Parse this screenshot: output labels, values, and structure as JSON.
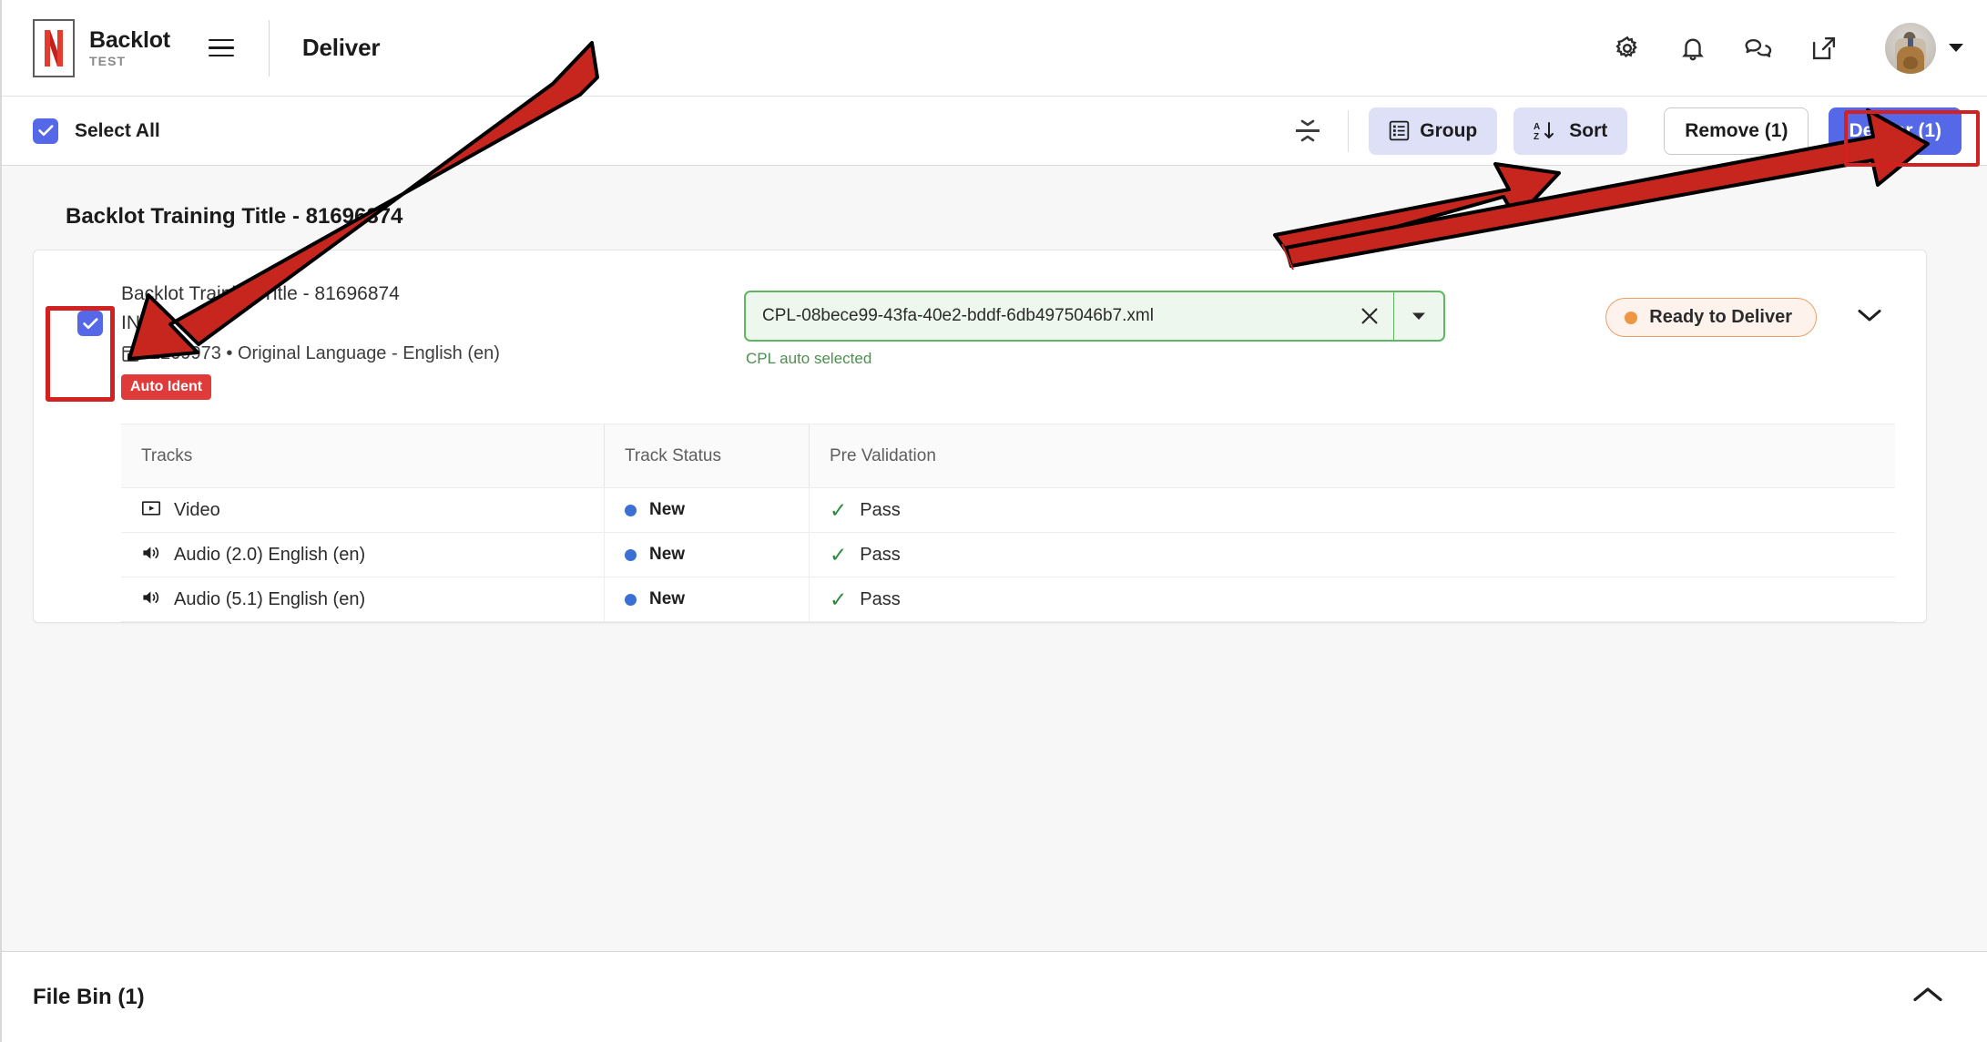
{
  "header": {
    "brand_name": "Backlot",
    "brand_sub": "TEST",
    "page_title": "Deliver",
    "logo_icon": "netflix-n-logo",
    "menu_icon": "hamburger-menu-icon",
    "icons": [
      {
        "name": "settings-gear-icon",
        "glyph": "gear"
      },
      {
        "name": "notifications-bell-icon",
        "glyph": "bell"
      },
      {
        "name": "chat-bubbles-icon",
        "glyph": "chat"
      },
      {
        "name": "open-external-icon",
        "glyph": "external-link"
      }
    ],
    "avatar_name": "user-avatar",
    "avatar_caret": "chevron-down-icon"
  },
  "toolbar": {
    "select_all_label": "Select All",
    "select_all_checked": true,
    "collapse_all_icon": "collapse-all-icon",
    "group_label": "Group",
    "group_icon": "list-icon",
    "sort_label": "Sort",
    "sort_icon": "sort-az-icon",
    "remove_label": "Remove (1)",
    "deliver_label": "Deliver (1)",
    "primary_color": "#5468e8",
    "soft_button_color": "#dde0f7"
  },
  "main": {
    "group_title": "Backlot Training Title - 81696874",
    "card": {
      "checkbox_checked": true,
      "title": "Backlot Training Title - 81696874",
      "subtitle": "IN",
      "meta_icon": "package-box-icon",
      "meta": "2209973 • Original Language - English (en)",
      "tag": "Auto Ident",
      "tag_color": "#e03b3b",
      "cpl_value": "CPL-08bece99-43fa-40e2-bddf-6db4975046b7.xml",
      "cpl_clear_icon": "clear-x-icon",
      "cpl_dropdown_icon": "caret-down-icon",
      "cpl_helper": "CPL auto selected",
      "cpl_border_color": "#5fb761",
      "status_label": "Ready to Deliver",
      "status_color": "#ef9644",
      "expand_icon": "chevron-down-icon"
    },
    "table": {
      "columns": [
        "Tracks",
        "Track Status",
        "Pre Validation"
      ],
      "rows": [
        {
          "icon": "video-icon",
          "track": "Video",
          "status": "New",
          "status_color": "#3b6fd4",
          "validation": "Pass",
          "validation_icon": "check-icon"
        },
        {
          "icon": "audio-icon",
          "track": "Audio (2.0) English (en)",
          "status": "New",
          "status_color": "#3b6fd4",
          "validation": "Pass",
          "validation_icon": "check-icon"
        },
        {
          "icon": "audio-icon",
          "track": "Audio (5.1) English (en)",
          "status": "New",
          "status_color": "#3b6fd4",
          "validation": "Pass",
          "validation_icon": "check-icon"
        }
      ]
    }
  },
  "filebin": {
    "title": "File Bin (1)",
    "collapse_icon": "chevron-up-icon"
  },
  "annotations": {
    "color": "#d32020",
    "arrow_to_checkbox": "arrow pointing at row checkbox",
    "arrow_to_deliver": "arrow pointing at Deliver (1) button",
    "box_checkbox": "highlight box around row checkbox",
    "box_deliver": "highlight box around Deliver (1) button"
  }
}
